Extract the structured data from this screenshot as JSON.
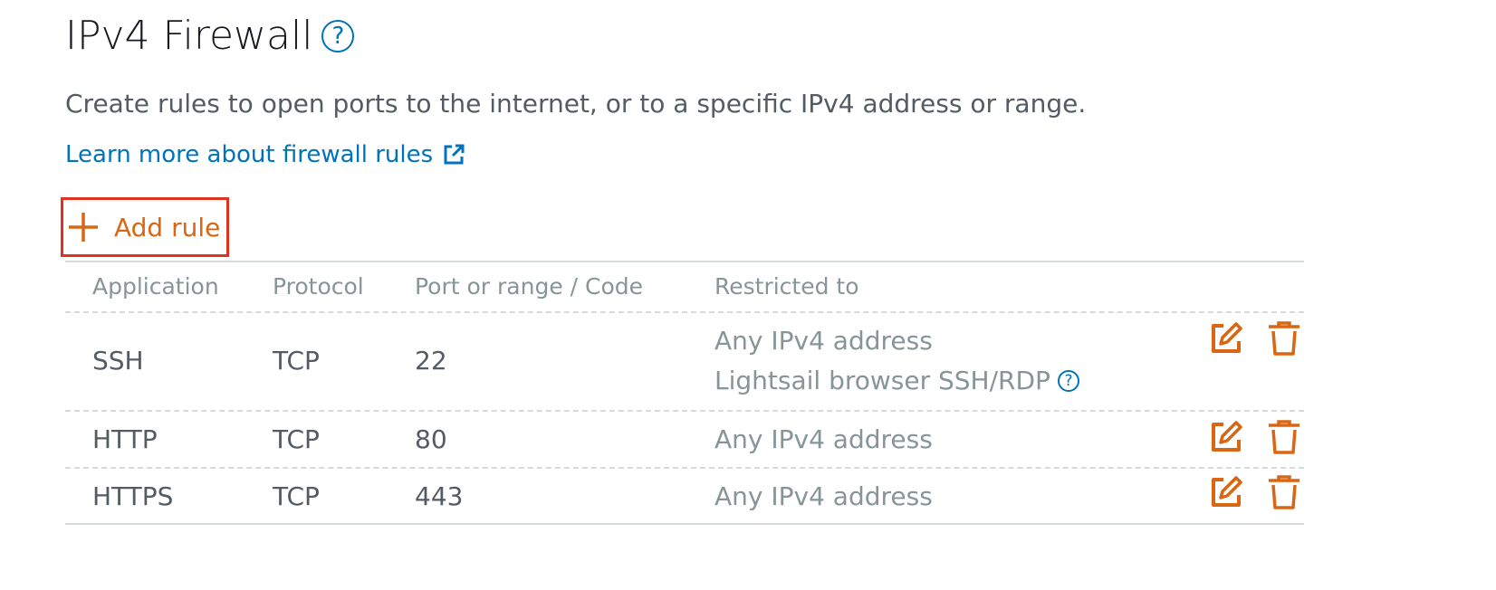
{
  "title": "IPv4 Firewall",
  "title_help_glyph": "?",
  "subtitle": "Create rules to open ports to the internet, or to a specific IPv4 address or range.",
  "learn_more": {
    "label": "Learn more about firewall rules",
    "icon": "external-link-icon"
  },
  "add_rule": {
    "label": "Add rule",
    "icon": "plus-icon"
  },
  "table": {
    "headers": {
      "application": "Application",
      "protocol": "Protocol",
      "port": "Port or range / Code",
      "restricted": "Restricted to"
    },
    "rows": [
      {
        "application": "SSH",
        "protocol": "TCP",
        "port": "22",
        "restricted": "Any IPv4 address",
        "note": "Lightsail browser SSH/RDP",
        "note_help_glyph": "?"
      },
      {
        "application": "HTTP",
        "protocol": "TCP",
        "port": "80",
        "restricted": "Any IPv4 address"
      },
      {
        "application": "HTTPS",
        "protocol": "TCP",
        "port": "443",
        "restricted": "Any IPv4 address"
      }
    ],
    "row_actions": {
      "edit_icon": "edit-icon",
      "delete_icon": "trash-icon"
    }
  },
  "colors": {
    "link": "#0073bb",
    "action": "#d86613",
    "highlight_border": "#e0321e",
    "heading_text": "#16191f",
    "body_text": "#545b64",
    "muted_text": "#879596",
    "divider": "#d5dbdb"
  }
}
